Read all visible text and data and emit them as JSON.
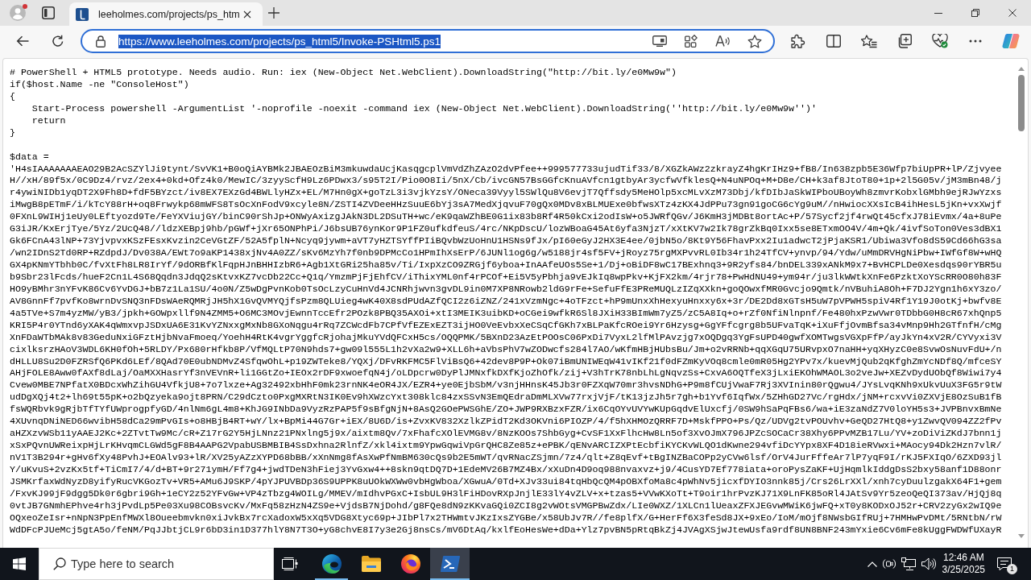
{
  "tabs": [
    {
      "title": "leeholmes.com/projects/ps_htm",
      "selected": true
    }
  ],
  "address_bar": {
    "url": "https://www.leeholmes.com/projects/ps_html5/Invoke-PSHtml5.ps1",
    "focused": true,
    "url_selected": true
  },
  "document": {
    "header_lines": [
      "# PowerShell + HTML5 prototype. Needs audio. Run: iex (New-Object Net.WebClient).DownloadString(\"http://bit.ly/e0Mw9w\")",
      "if($host.Name -ne \"ConsoleHost\")",
      "{",
      "    Start-Process powershell -ArgumentList '-noprofile -noexit -command iex (New-Object Net.WebClient).DownloadString(''http://bit.ly/e0Mw9w'')'",
      "    return",
      "}"
    ],
    "data_label": "$data =",
    "data_lines": [
      "'H4sIAAAAAAAEAO29B2AcSZYlJi9tynt/SvVK1+B0oQiAYBMk2JBAEOzBiM3mkuwdaUcjKasqgcplVmVdZhZAzO2dvPfee++999577733ujudTif33/8/XGZkAWz2zkrayZ4hgKrIHz9+fB8/In638zpb5E36Wfp7biUpPR+lP/Zjvyee",
      "H//xH/89f5x/0C9Dz4/rvz/2ex4+0kd+Ofz4k0/MewIC/3zyyScfH9Lz6PDwx3/s95T2I/Pio0O8Ii/5nX/Cb/ivcGN57BsGGfcKnuAVfcn1gtbyAr3ycfwVfklesQ+N4uNPOq+M+D8e/CH+k3af8JtoT80+1p+2l5G05v/jM3mBn48/j",
      "r4ywiNIDb1yqDT2X9Fh8D+fdF5BYzct/iv8EX7EXzGd4BWLlyHZx+EL/M7Hn0gX+goTzL3i3vjkYzsY/ONeca39Vyyl5SWlQu8V6evjT7Qffsdy5MeHOlp5xcMLvXzM73Dbj/kfDIbJaSkWIPboUBoyWh8zmvrKobxlGMbh9ejRJwYzxs",
      "iMwgB8pETmF/i/kTcY88rH+oq8Frwykp68mWFS8TsOcXnFodV9xcyle8N/ZSTI4ZVDeeHHzSuuE6bYj3sA7MedXjqvuF70gQx0MDv8xBLMUExe0bfwsXTz4zKX4JdPPu73gn91goCG6cYg9uM//nHwiocXXsIcB4ihHesL5jKn+vxXwjf",
      "0FXnL9WIHj1eUy0LEftyozd9Te/FeYXViujGY/binC90rShJp+ONWyAxizgJAkN3DL2DSuTH+wc/eK9qaWZhBE0G1ix83b8Rf4R50kCxi2odIsW+o5JWRfQGv/J6KmH3jMDBt8ortAc+P/57Sycf2jf4rwQt45cfxJ78iEvmx/4a+8uPe",
      "G3iJR/KxErjTye/5Yz/2UcQ48//ldzXEBpj9hb/pGWf+jXr65ONPhPi/J6bsUB76ynKor9P1FZ0ufkdfeuS/4rc/NKpDscU/lozWBoaG45At6yfa3NjzT/xXtKV7w2Ik78grZkBq0Ixx5se8ETxmOO4V/4m+Qk/4ivfSoTon0Ves3dBX1",
      "Gk6FCnA43lNP+73YjvpvxKSzFEsxKvzin2CeVGtZF/52A5fplN+Ncyq9jywm+aVT7yHZTSYffPIiBQvbWzUoHnU1HSNs9fJx/pI60eGyJ2HX3E4ee/0jbN5o/8Kt9Y56FhavPxx2Iu1adwcT2jPjaKSR1/Ubiwa3Vfo8dS59Cd66hG3sa",
      "/wn2IDnS2Td0RP+RZdpdJ/Dv038A/EWt7o9aKP1438xjNv4A0ZZ/sKv6MzYh7f0nb9DPMcCo1HPmIhXsErP/6JUNl1og6g/w5188jr4sf5FV+jRoyz75rgMXPvvRL0Ib34r1h24TfCV+ynvp/94/Ydw/uMmDRVHgNiPbw+IWfGf8W+wHQ",
      "GX4pKNmYTbhb0C/fvXtFh8LR8IrYf/9dORBfKlFqpHJnBHHIzbR6+Agb1XtGRi25ha85v/Ti/IxpXzCO9ZRGjf6yboa+InAAfeUOs5Se+1/Dj+oBiDF8wC17BExhnq3+9R2yfs84/bnDEL339xANkM9x7+BvHCPLDe0Xesdqs90rYBR5u",
      "b9Sbr23lFcds/hueF2Cn1L4S68Qqdn3JdqQ2sKtvxKZ7vcDb22Cc+Q1q/YmzmPjFjEhfCV/iThixYML0nf4rPCOf+Ei5V5yPbhja9vEJkIq8wpPkv+KjFX2km/4rjr78+PwHdNU49+ym94r/ju3lkWWtkXnFe6PzktXoYScRR0O80h83F",
      "HO9yBMhr3nYFvK86Cv6YvDGJ+bB7z1La1SU/4o0N/Z5wDgPvnKob0TsOcLzyCuHnVd4JCNRhjwvn3gvDL9in0M7XP8NRowb2ldG9rFe+SefuFfE3PReMUQLzIZqXXkn+goQOwxfMR0Gvcjo9Qmtk/nVBuhiA8Oh+F7DJ2Ygn1h6xY3zo/",
      "AV8GnnFf7pvfKo8wrnDvSNQ3nFDsWAeRQMRjJH5hX1GvQVMYQjfsPzm8QLUieg4wK40X8sdPUdAZfQCI2z6iZNZ/241xVzmNgc+4oTFzct+hP9mUnxXhHexyuHnxxy6x+3r/DE2Dd8xGTsH5uW7pVPWH5spiV4Rf1Y19J0otKj+bwfv8E",
      "4a5TVe+S7m4yzMW/yB3/jpkh+GOWpxllf9N4ZMM5+O6MC3MOvjEwnnTccEfr2POzk8PBQ35AXOi+xtI3MEIK3uibKD+oCGei9wfkR6Sl8JXiH33BImWm7yZ5/zC5A8Iq+o+rZf0NfiNlnpnf/Fe480hxPzwVwr0TDbbG0H8cR67xhQnp5",
      "KRI5P4r0YTnd6yXAK4qWmxvpJSDxUA6E31KvYZNxxgMxNb8GXoNqgu4rRq7ZCWcdFb7CPfVfEZExEZT3ijHO0VeEvbxXeCSqCfGKh7xBLPaKfcROei9Yr6Hzysg+GgYFfcgrg8b5UFvaTqK+iXuFfjOvmBfsa34vMnp9Hh2GTfnfH/cMg",
      "XnFDaWTbMAk8v83GeduNxiGFztHjbNvaFmoeq/YoehH4RtK4vgrYggfcRjohajMkuYVdQFCxH5cs/OQQPMK/5BXnD23AzEtPOOsC06PxDi7VyxL2lfMlPAvzjg7xOQDgq3YgFsUPD40gwfXOMTwgsVGXpFfP/ayJkYn4xV2R/CYVyxi3V",
      "cixlksrzHAoV3WDL6KH0fOh+5RLDY/Px680rHfkb8P/VfMQLtP70N9hds7+gw09l555L1h2vXa2w9+XLL6h+aVbsPhV7wZODwcfs284l7AO/wKfmHBjHUbsBu/Jm+o2vRRNb+qqXGqU75URvpxO7naHH+yqXHyzC0e8SvwOsNuvFdU+/n",
      "dHLLU8Su2D0FZRSfQ6PKd6LEf/8QAd70E0ubNDMvZ4SfqwOhL+p19ZWTeke8/YQXj/DFvRKFMC5FlViBsQ6+42dev8P9P+Ok07iBmUNIWEqW41vIKf21f0dFZmKyVOq8cmle0mR05Hg2YPv7x/kuevMjQub2qKfghZmYcNDf8Q/mfceSY",
      "AHjFOLE8Aww0fAXf8dLaj/OaMXXHasrYf3nVEVnR+li1GGtZo+IEOx2rDF9xwoefqN4j/oLDpcrw0DyPlJMNxfkDXfKjoZhOfk/zij+V3hTrK78nbLhLgNqvzSs+CxvA6OQTfeX3jLxiEKOhWMAOL3o2veJw+XEZvDydUObQf8Wiwi7y4",
      "Cvew0MBE7NPfatX0BDcxWhZihGU4VfkjU8+7o7lxze+Ag32492xbHhF0mk23rnNK4eOR4JX/EZR4+ye0EjbSbM/v3njHHnsK45Jb3r0FZXqW70mr3hvsNDhG+P9m8fCUjVwaF7Rj3XVInin80rQgwu4/JYsLvqKNh9xUkvUuX3FG5r9tW",
      "udDgXQj4t2+lh69t55pK+o2bQzyeka9ojt8PRN/C29dCzto0PxgMXRtN3IK0Ev9hXWzcYxt308klc84zxSSvN3EmQEdraDmMLXVw77rxjVjF/tK13jzJh5r7gh+b1Yvf6IqfWx/5ZHhGD27Vc/rgHdx/jNM+rcxvVi0ZXVjE8OzSuB1fB",
      "fsWQRbvk9gRjbTfTYfUWprogpfyGD/4nlNm6gL4m8+KhJG9INbDa9VyzRzPAP5f9sBfgNjN+8AsQ2GOePWSGhE/ZO+JWP9RXBzxFZR/ix6CqOYvUVYwKUpGqdvElUxcfj/0SW9hSaPqFBs6/wa+iE3zaNdZ7V0loYH5s3+JVPBnvxBmNe",
      "4XUvnqDNiNED66wvibH58dCa29mPvGIs+o8HBjB4RT+wY/lx+BpMi44G7Gr+iEX/8U6D/is+ZvxKV832XzlkZPidT2Kd3OKVni6PIOZP/4/f5hXHMOzQRRF7D+MskfPPO+Ps/Qz/UDVg2tvPOUvhv+GeQD27HtQ8+y1ZwvQV094ZZ2fPv",
      "aHZXzvWSb11yAAEJ2Kc+2ZTvtTw9Mc/cR+Z17rG2Y5HjLNnz21PNxlng5j9x/aixtm8Qv/7xFhafcXOlEVMG8v/8NzKOOs7ShbGyg+CvSF1XxFlhcHw8Ln5of3XvOJmX796JPZcSOCaCr38Xhy6PPvMZB17Lu/YV+zoDiViZKdJ7bnn1j",
      "xSxPQvnUWReixpHjLrKHvqmCLGWd5gF8B4AAPG2VpabUSBMBIB4SsDxhna2RlnfZ/xkl4ixtm9YpwGqwiVpGrQHC8Ze85z+ePBK/qENvARCIZXPtEcbfiKYCKvWLQO1dKwne294vfiDcYYpx8XF4D18ieRVwxi+MAocy94Dk2Hzn7vlR/",
      "nV1T3B294r+gHv6fXy48PvhJ+EOAlv93+lR/XV25yAZzXYPD68bBB/xXnNmg8fAsXwPfNmBM630cQs9b2E5mWT/qvRNacZSjmn/7z4/qlt+Z8qEvf+tBgINZBaCOPp2yCVw6lsf/OrV4JurFffeAr7lP7yqF9I/rKJ5FXIqO/6ZXD93jl",
      "Y/uKvuS+2vzKx5tf+TiCmI7/4/d+BT+9r271ymH/Ff7g4+jwdTDeN3hFiej3YvGxw4++8skn9qtDQ7D+1EdeMV26B7MZ4Bx/xXuDn4D9oq988nvaxvz+j9/4CusYD7Ef778iata+oroPysZaKF+UjHqmlkIddgDsS2bxy58anf1D88onr",
      "JSMKrfaxWdNyzD8yifyRucVKGozTv+VR5+AMu6J9SKP/4pYJPUVBDp36S9UPPK8uUOkWXWw0vbHgWboa/XGwuA/0Td+XJv33ui84tqHbQcQM4pOBXfoMa8c4pWhNv5jicxfDYIO3nnk85j/Crs26LrXXl/xnh7cyDuulzgakX64F1+gem",
      "/FxvKJ99jF9dgg5Dk0r6gbri9Gh+1eCY2z52YFvGw+VP4zTbzg4WOILg/MMEV/mIdhvPGxC+IsbUL9H3lFiHDovRXpJnjlE33lY4vZLV+x+tzas5+VVwKXoTt+T9oir1hrPvzKJ71X9LnFK85oRl4JAtSv9Yr5zeoQeQI373av/HjQj8q",
      "0vtJB7GNmhEPhve4rh3jPvdLp5Pe03Xu98COBsvcKv/MxFq58zHzN4ZS9e+VjdsB7NjDohd/g8FQe8dN9zKKvaGQi0ZCI8g2vWOtsVMGPBwZdx/LIe0WXZ/1XLCn1lUeaxZFXJEGvwMWiK6jwFQ+xT0y8KODxOJ52r+CRV2zyGx2wIQ9e",
      "OQxeoZeIsr+nNpN3PpEnfMWXl8Oueebmvkn0xiJvkBx7rcXadoxW5xXq5VDG8Xtyc69p+JIbPl7x2THWmtvJKzIxsZYGBe/x58UbJv7R//fe8plfX/G+HerFf6X3feSd8JX+9xEo/IoM/mOjf8NWsbGIfRUj+7HMHwPvDMt/5RNtbN/rW",
      "WdDFcPJUeMcj5gtA5o/feNM/PqJJbtjCL9r6bD3in1D377hlY8N7T3O+yG8chvE8I7y3e2Gj8nsCs/mV6DtAq/kxlfEoHesWe+dDa+Ylz7pvBN5pRtqBkZj4JVAgXSjwJtewUsfa9rdf8UN8BNF243mYxie6Cv6mFe8kUggFWDWfUXayR"
    ]
  },
  "taskbar": {
    "search": {
      "placeholder": "Type here to search"
    },
    "apps": [
      {
        "kind": "edge",
        "running": true,
        "selected": false
      },
      {
        "kind": "file-explorer",
        "running": false,
        "selected": false
      },
      {
        "kind": "firefox",
        "running": false,
        "selected": false
      },
      {
        "kind": "powershell",
        "running": true,
        "selected": true
      }
    ],
    "clock": {
      "time": "12:46 AM",
      "date": "3/25/2025"
    },
    "notification_count": "1"
  }
}
